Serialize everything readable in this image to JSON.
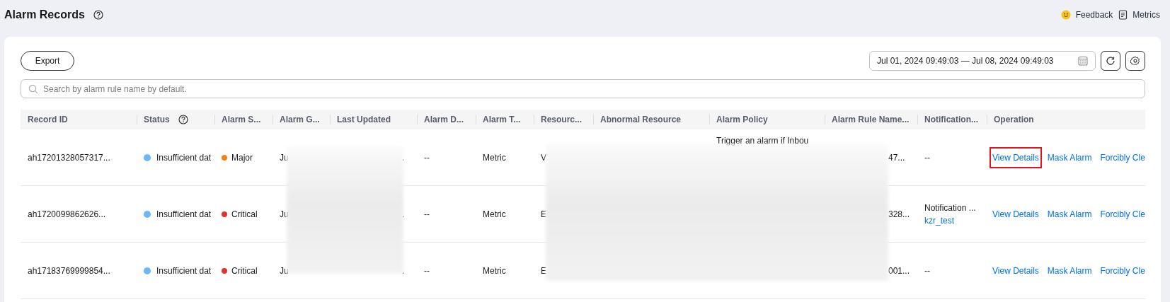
{
  "page": {
    "title": "Alarm Records",
    "links": [
      {
        "label": "Feedback",
        "kind": "smiley"
      },
      {
        "label": "Metrics",
        "kind": "document"
      }
    ]
  },
  "toolbar": {
    "export": "Export",
    "date_range": "Jul 01, 2024 09:49:03 — Jul 08, 2024 09:49:03"
  },
  "search": {
    "placeholder": "Search by alarm rule name by default."
  },
  "table": {
    "columns": [
      {
        "label": "Record ID",
        "kind": "plain"
      },
      {
        "label": "Status",
        "kind": "help"
      },
      {
        "label": "Alarm S...",
        "kind": "plain"
      },
      {
        "label": "Alarm G...",
        "kind": "plain"
      },
      {
        "label": "Last Updated",
        "kind": "plain"
      },
      {
        "label": "Alarm D...",
        "kind": "plain"
      },
      {
        "label": "Alarm T...",
        "kind": "plain"
      },
      {
        "label": "Resourc...",
        "kind": "plain"
      },
      {
        "label": "Abnormal Resource",
        "kind": "plain"
      },
      {
        "label": "Alarm Policy",
        "kind": "plain"
      },
      {
        "label": "Alarm Rule Name...",
        "kind": "plain"
      },
      {
        "label": "Notification...",
        "kind": "plain"
      },
      {
        "label": "Operation",
        "kind": "plain"
      }
    ],
    "rows": [
      {
        "record_id": "ah17201328057317...",
        "status": {
          "label": "Insufficient dat",
          "color": "#6cb8f7"
        },
        "severity": {
          "label": "Major",
          "color": "#f5820b"
        },
        "alarm_generated": "Ju",
        "last_updated": ".",
        "alarm_duration": "--",
        "alarm_type": "Metric",
        "resource": "V",
        "policy": "Trigger an alarm if Inbou",
        "rule_name": "47...",
        "notification": [
          {
            "text": "--",
            "kind": "text"
          }
        ],
        "operations": [
          {
            "label": "View Details",
            "highlighted": true
          },
          {
            "label": "Mask Alarm",
            "highlighted": false
          },
          {
            "label": "Forcibly Cle",
            "highlighted": false
          }
        ]
      },
      {
        "record_id": "ah1720099862626...",
        "status": {
          "label": "Insufficient dat",
          "color": "#6cb8f7"
        },
        "severity": {
          "label": "Critical",
          "color": "#e8302f"
        },
        "alarm_generated": "Ju",
        "last_updated": ".",
        "alarm_duration": "--",
        "alarm_type": "Metric",
        "resource": "E",
        "rule_name": "328...",
        "notification": [
          {
            "text": "Notification ...",
            "kind": "text"
          },
          {
            "text": "kzr_test",
            "kind": "link"
          }
        ],
        "operations": [
          {
            "label": "View Details",
            "highlighted": false
          },
          {
            "label": "Mask Alarm",
            "highlighted": false
          },
          {
            "label": "Forcibly Cle",
            "highlighted": false
          }
        ]
      },
      {
        "record_id": "ah17183769999854...",
        "status": {
          "label": "Insufficient dat",
          "color": "#6cb8f7"
        },
        "severity": {
          "label": "Critical",
          "color": "#e8302f"
        },
        "alarm_generated": "Ju",
        "last_updated": ".",
        "alarm_duration": "--",
        "alarm_type": "Metric",
        "resource": "E",
        "rule_name": "001...",
        "notification": [
          {
            "text": "--",
            "kind": "text"
          }
        ],
        "operations": [
          {
            "label": "View Details",
            "highlighted": false
          },
          {
            "label": "Mask Alarm",
            "highlighted": false
          },
          {
            "label": "Forcibly Cle",
            "highlighted": false
          }
        ]
      }
    ]
  }
}
